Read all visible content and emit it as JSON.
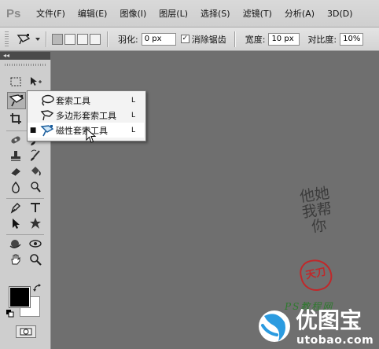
{
  "app": {
    "logo": "Ps"
  },
  "menu": [
    "文件(F)",
    "编辑(E)",
    "图像(I)",
    "图层(L)",
    "选择(S)",
    "滤镜(T)",
    "分析(A)",
    "3D(D)"
  ],
  "options": {
    "feather_label": "羽化:",
    "feather_value": "0 px",
    "antialias_label": "消除锯齿",
    "antialias_checked": "✓",
    "width_label": "宽度:",
    "width_value": "10 px",
    "contrast_label": "对比度:",
    "contrast_value": "10%"
  },
  "panel": {
    "collapse_glyph": "◂◂"
  },
  "flyout": {
    "items": [
      {
        "label": "套索工具",
        "shortcut": "L",
        "selected": false,
        "icon": "lasso-icon"
      },
      {
        "label": "多边形套索工具",
        "shortcut": "L",
        "selected": false,
        "icon": "polygonal-lasso-icon"
      },
      {
        "label": "磁性套索工具",
        "shortcut": "L",
        "selected": true,
        "icon": "magnetic-lasso-icon"
      }
    ],
    "bullet": "■"
  },
  "watermark": {
    "calligraphy": "他她我帮你",
    "seal": "天刀",
    "ps_text": "PS教程网",
    "brand": "优图宝",
    "url": "utobao.com"
  },
  "colors": {
    "canvas": "#6f6f6f",
    "foreground": "#000000",
    "background": "#ffffff",
    "brand_blue": "#2b9be0",
    "seal_red": "#c0282a"
  }
}
